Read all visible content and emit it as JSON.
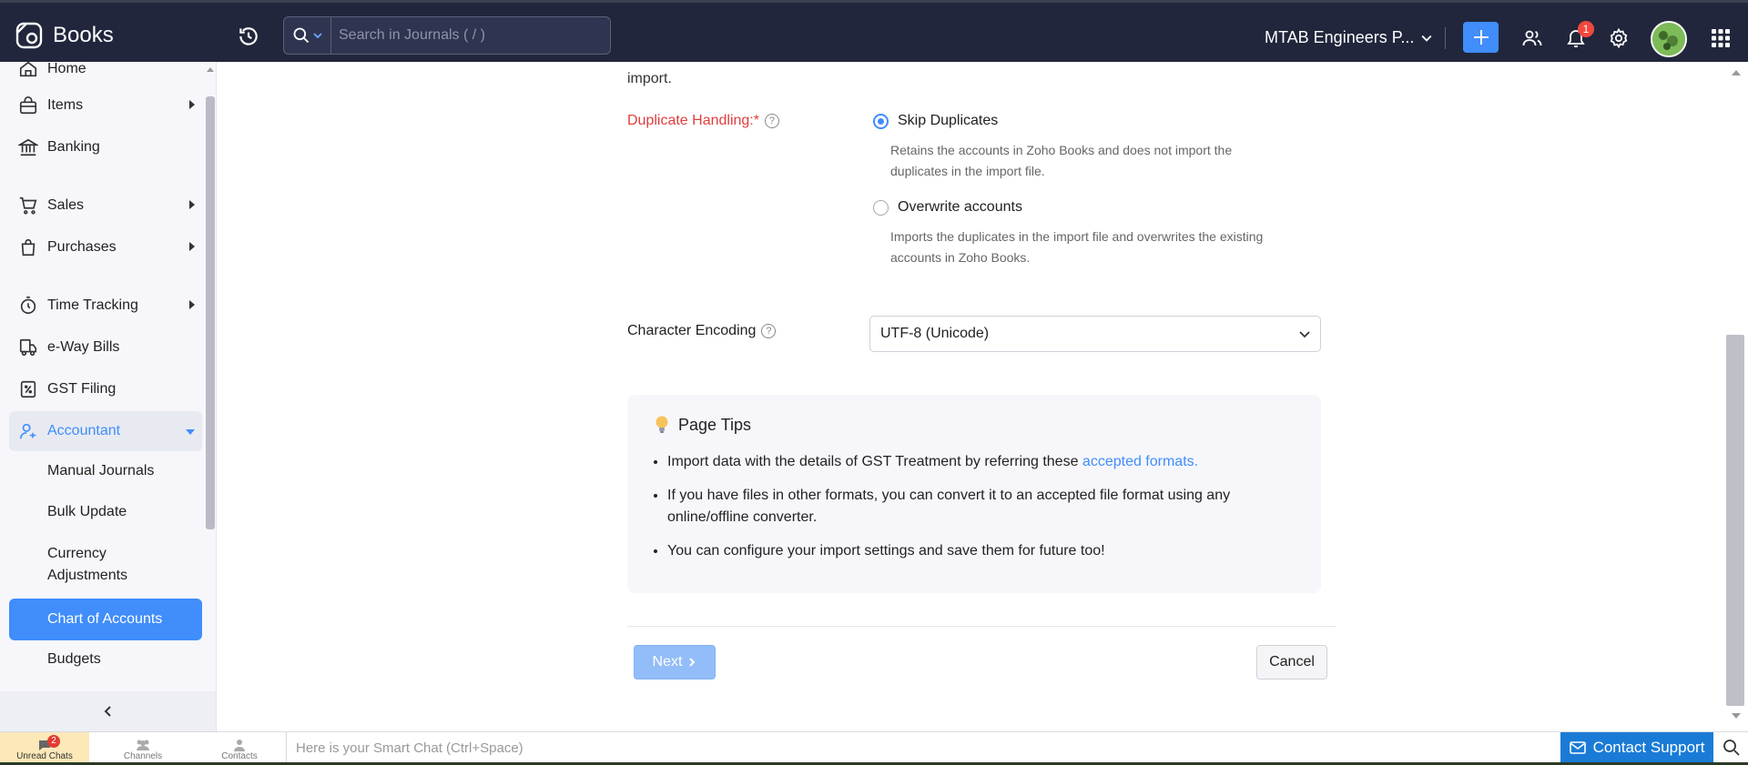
{
  "app": {
    "name": "Books",
    "org_name": "MTAB Engineers P...",
    "notifications_count": "1"
  },
  "search": {
    "placeholder": "Search in Journals ( / )"
  },
  "sidebar": {
    "items": [
      {
        "label": "Home",
        "icon": "home-icon"
      },
      {
        "label": "Items",
        "icon": "bag-icon"
      },
      {
        "label": "Banking",
        "icon": "bank-icon"
      },
      {
        "label": "Sales",
        "icon": "cart-icon"
      },
      {
        "label": "Purchases",
        "icon": "shopping-bag-icon"
      },
      {
        "label": "Time Tracking",
        "icon": "stopwatch-icon"
      },
      {
        "label": "e-Way Bills",
        "icon": "truck-icon"
      },
      {
        "label": "GST Filing",
        "icon": "gst-doc-icon"
      },
      {
        "label": "Accountant",
        "icon": "user-accountant-icon"
      }
    ],
    "sub_items": [
      {
        "label": "Manual Journals"
      },
      {
        "label": "Bulk Update"
      },
      {
        "label": "Currency Adjustments"
      },
      {
        "label": "Chart of Accounts"
      },
      {
        "label": "Budgets"
      }
    ]
  },
  "form": {
    "cut_text": "import.",
    "duplicate_label": "Duplicate Handling:*",
    "options": [
      {
        "label": "Skip Duplicates",
        "desc": "Retains the accounts in Zoho Books and does not import the duplicates in the import file.",
        "checked": true
      },
      {
        "label": "Overwrite accounts",
        "desc": "Imports the duplicates in the import file and overwrites the existing accounts in Zoho Books.",
        "checked": false
      }
    ],
    "encoding_label": "Character Encoding",
    "encoding_value": "UTF-8 (Unicode)",
    "help_glyph": "?"
  },
  "tips": {
    "title": "Page Tips",
    "item1_text": "Import data with the details of GST Treatment by referring these ",
    "item1_link": "accepted formats.",
    "item2": "If you have files in other formats, you can convert it to an accepted file format using any online/offline converter.",
    "item3": "You can configure your import settings and save them for future too!"
  },
  "buttons": {
    "next": "Next",
    "cancel": "Cancel"
  },
  "bottombar": {
    "unread_chats": "Unread Chats",
    "unread_count": "2",
    "channels": "Channels",
    "contacts": "Contacts",
    "smart_chat_placeholder": "Here is your Smart Chat (Ctrl+Space)",
    "contact_support": "Contact Support"
  },
  "colors": {
    "accent": "#408dfb",
    "topbar": "#21263c",
    "required": "#e03d3d",
    "support": "#1a7bd6"
  }
}
